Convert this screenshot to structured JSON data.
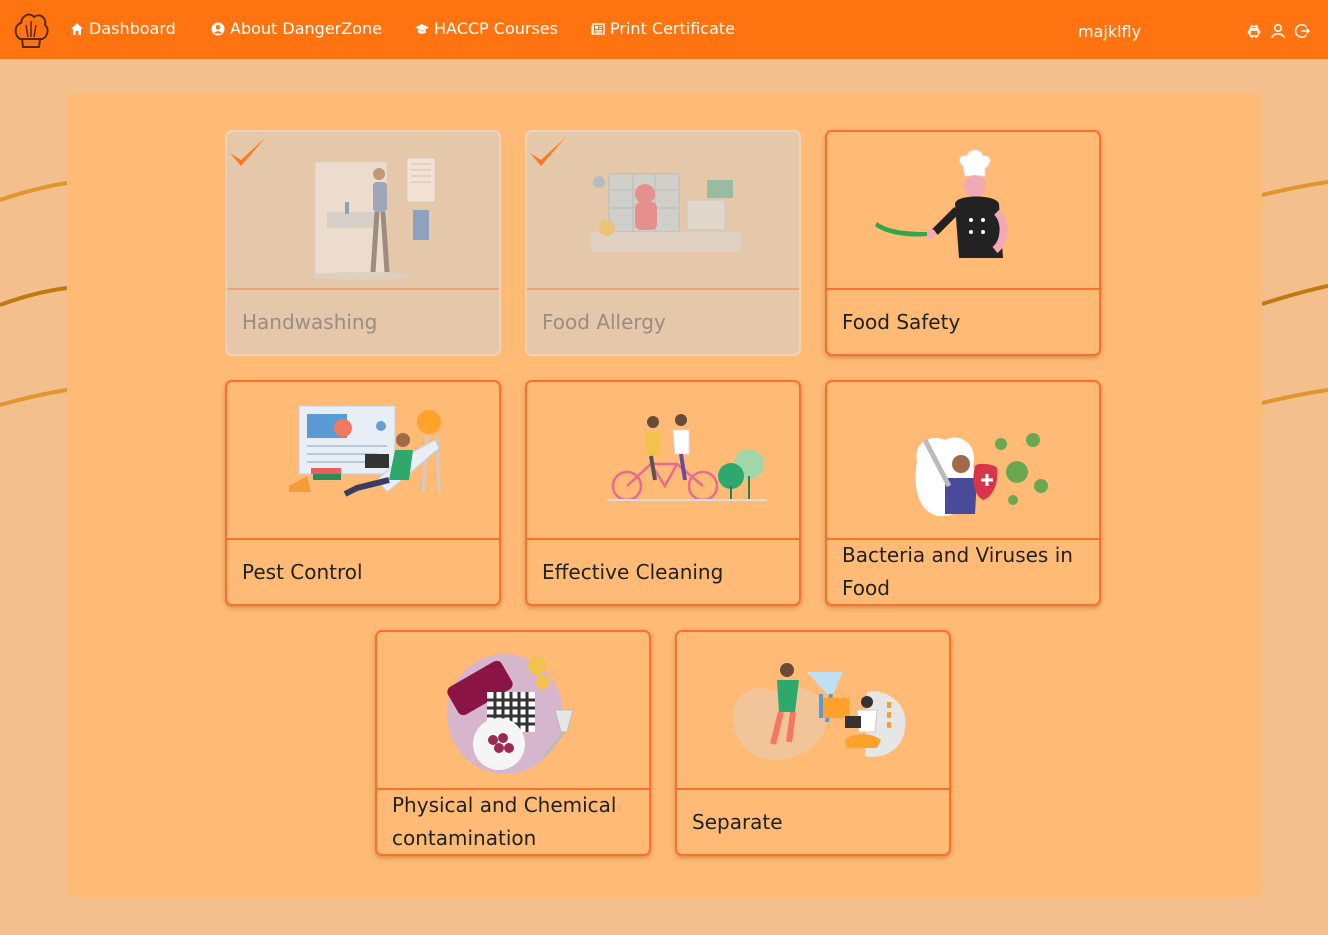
{
  "nav": {
    "items": [
      {
        "label": "Dashboard",
        "icon": "home-icon"
      },
      {
        "label": "About DangerZone",
        "icon": "user-circle-icon"
      },
      {
        "label": "HACCP Courses",
        "icon": "graduation-cap-icon"
      },
      {
        "label": "Print Certificate",
        "icon": "newspaper-icon"
      }
    ],
    "username": "majklfly",
    "right_icons": [
      "android-icon",
      "user-icon",
      "logout-icon"
    ]
  },
  "courses": [
    {
      "title": "Handwashing",
      "completed": true,
      "illustration": "handwashing-illustration"
    },
    {
      "title": "Food Allergy",
      "completed": true,
      "illustration": "food-allergy-illustration"
    },
    {
      "title": "Food Safety",
      "completed": false,
      "illustration": "chef-illustration"
    },
    {
      "title": "Pest Control",
      "completed": false,
      "illustration": "pest-control-illustration"
    },
    {
      "title": "Effective Cleaning",
      "completed": false,
      "illustration": "tandem-bicycle-illustration"
    },
    {
      "title": "Bacteria and Viruses in Food",
      "completed": false,
      "illustration": "virus-defence-illustration"
    },
    {
      "title": "Physical and Chemical contamination",
      "completed": false,
      "illustration": "wine-and-grapes-illustration"
    },
    {
      "title": "Separate",
      "completed": false,
      "illustration": "separate-illustration"
    }
  ],
  "colors": {
    "navbar": "#ff7410",
    "panel": "#ffba75",
    "background": "#f3bf8d",
    "card_border": "#f9712a",
    "check": "#f97b1e"
  }
}
